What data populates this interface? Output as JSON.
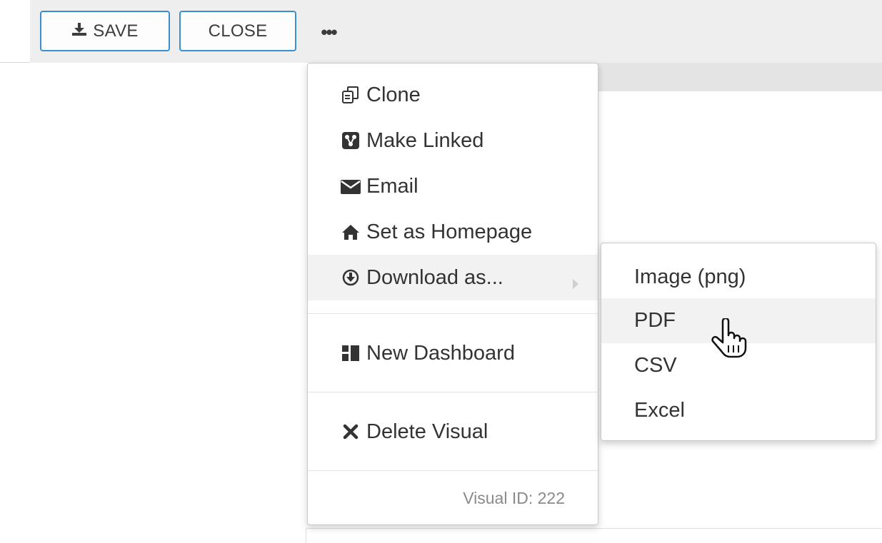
{
  "toolbar": {
    "save_label": "SAVE",
    "close_label": "CLOSE",
    "more_label": "•••"
  },
  "menu": {
    "items": [
      {
        "label": "Clone",
        "icon": "clone-icon"
      },
      {
        "label": "Make Linked",
        "icon": "link-icon"
      },
      {
        "label": "Email",
        "icon": "envelope-icon"
      },
      {
        "label": "Set as Homepage",
        "icon": "home-icon"
      },
      {
        "label": "Download as...",
        "icon": "download-circle-icon"
      },
      {
        "label": "New Dashboard",
        "icon": "dashboard-icon"
      },
      {
        "label": "Delete Visual",
        "icon": "close-x-icon"
      }
    ],
    "footer": "Visual ID: 222"
  },
  "submenu": {
    "items": [
      {
        "label": "Image (png)"
      },
      {
        "label": "PDF"
      },
      {
        "label": "CSV"
      },
      {
        "label": "Excel"
      }
    ]
  },
  "colors": {
    "accent_border": "#3a8fd1",
    "toolbar_bg": "#eeeeee",
    "hover_bg": "#f2f2f2"
  }
}
